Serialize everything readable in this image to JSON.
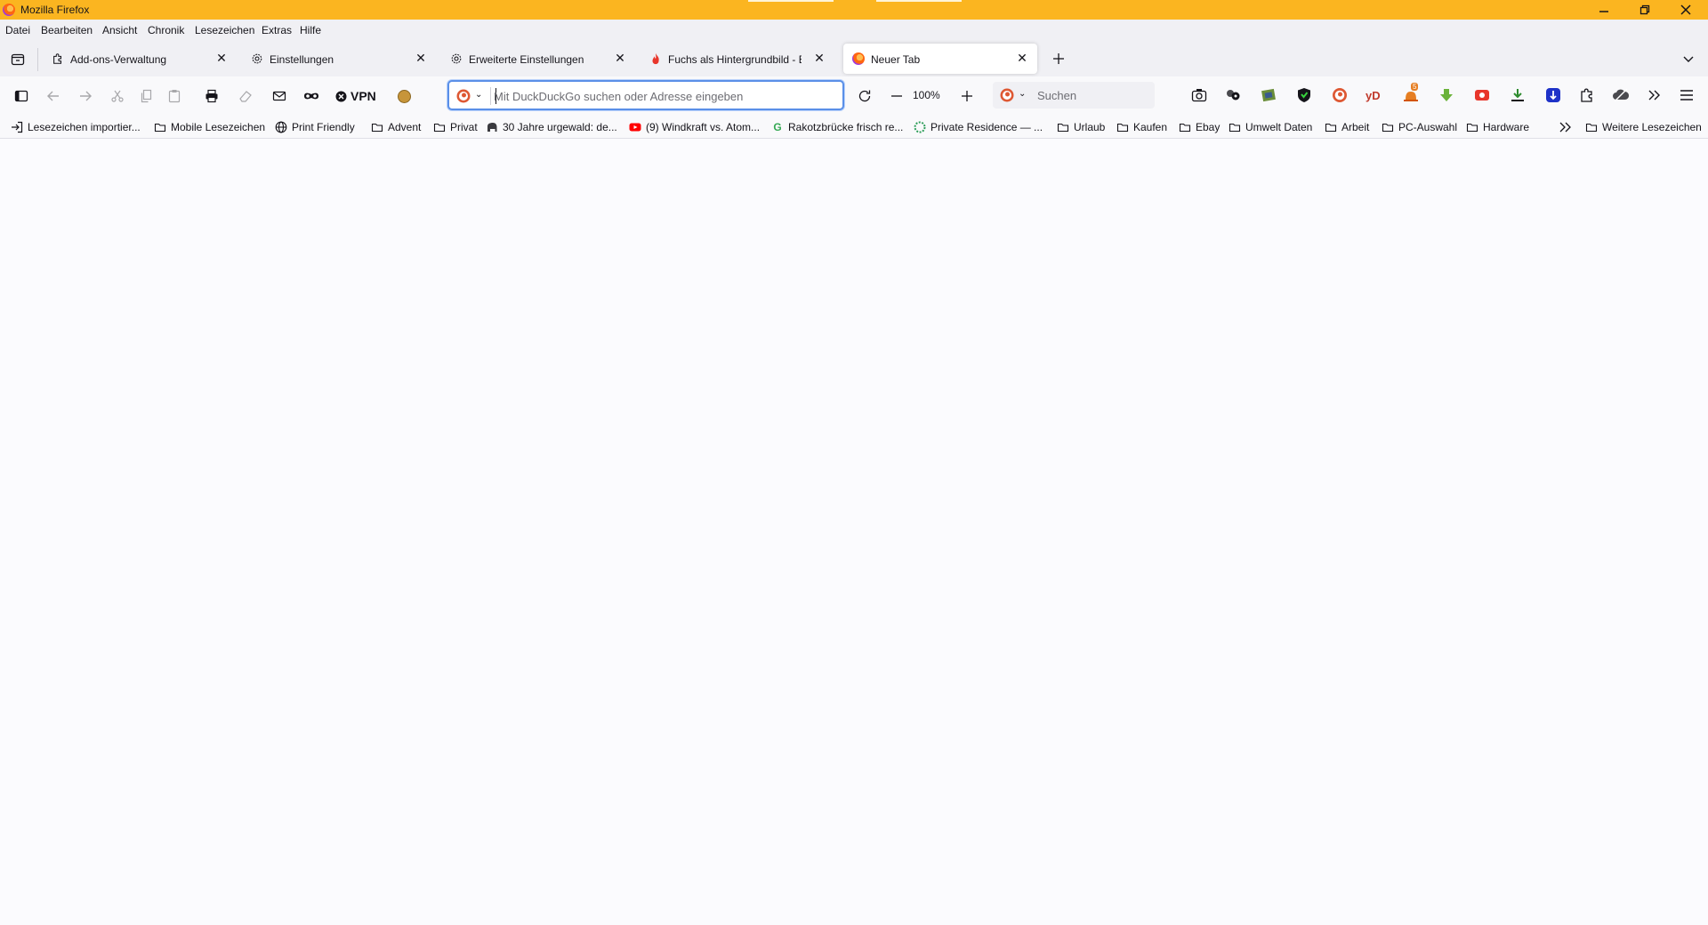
{
  "window": {
    "title": "Mozilla Firefox",
    "colors": {
      "titlebar": "#fbb520",
      "urlbar_focus": "#5a8fe8"
    }
  },
  "menubar": [
    {
      "label": "Datei",
      "underline": "D"
    },
    {
      "label": "Bearbeiten",
      "underline": "B"
    },
    {
      "label": "Ansicht",
      "underline": "A"
    },
    {
      "label": "Chronik",
      "underline": "C"
    },
    {
      "label": "Lesezeichen",
      "underline": "L"
    },
    {
      "label": "Extras",
      "underline": "E"
    },
    {
      "label": "Hilfe",
      "underline": "H"
    }
  ],
  "tabs": [
    {
      "label": "Add-ons-Verwaltung",
      "icon": "puzzle-icon",
      "active": false
    },
    {
      "label": "Einstellungen",
      "icon": "gear-icon",
      "active": false
    },
    {
      "label": "Erweiterte Einstellungen",
      "icon": "gear-icon",
      "active": false
    },
    {
      "label": "Fuchs als Hintergrundbild - Erw",
      "icon": "fire-icon",
      "active": false
    },
    {
      "label": "Neuer Tab",
      "icon": "firefox-icon",
      "active": true
    }
  ],
  "navbar": {
    "vpn_label": "VPN",
    "url_placeholder": "Mit DuckDuckGo suchen oder Adresse eingeben",
    "url_value": "",
    "zoom": "100%",
    "search_placeholder": "Suchen",
    "ext_badge": "5"
  },
  "bookmarks": [
    {
      "label": "Lesezeichen importier...",
      "icon": "import-icon"
    },
    {
      "label": "Mobile Lesezeichen",
      "icon": "folder-icon"
    },
    {
      "label": "Print Friendly",
      "icon": "globe-icon"
    },
    {
      "label": "Advent",
      "icon": "folder-icon"
    },
    {
      "label": "Privat",
      "icon": "folder-icon"
    },
    {
      "label": "30 Jahre urgewald: de...",
      "icon": "elephant-icon"
    },
    {
      "label": "(9) Windkraft vs. Atom...",
      "icon": "youtube-icon"
    },
    {
      "label": "Rakotzbrücke frisch re...",
      "icon": "google-icon"
    },
    {
      "label": "Private Residence — ...",
      "icon": "residence-icon"
    },
    {
      "label": "Urlaub",
      "icon": "folder-icon"
    },
    {
      "label": "Kaufen",
      "icon": "folder-icon"
    },
    {
      "label": "Ebay",
      "icon": "folder-icon"
    },
    {
      "label": "Umwelt Daten",
      "icon": "folder-icon"
    },
    {
      "label": "Arbeit",
      "icon": "folder-icon"
    },
    {
      "label": "PC-Auswahl",
      "icon": "folder-icon"
    },
    {
      "label": "Hardware",
      "icon": "folder-icon"
    }
  ],
  "bookmarks_more": "Weitere Lesezeichen"
}
